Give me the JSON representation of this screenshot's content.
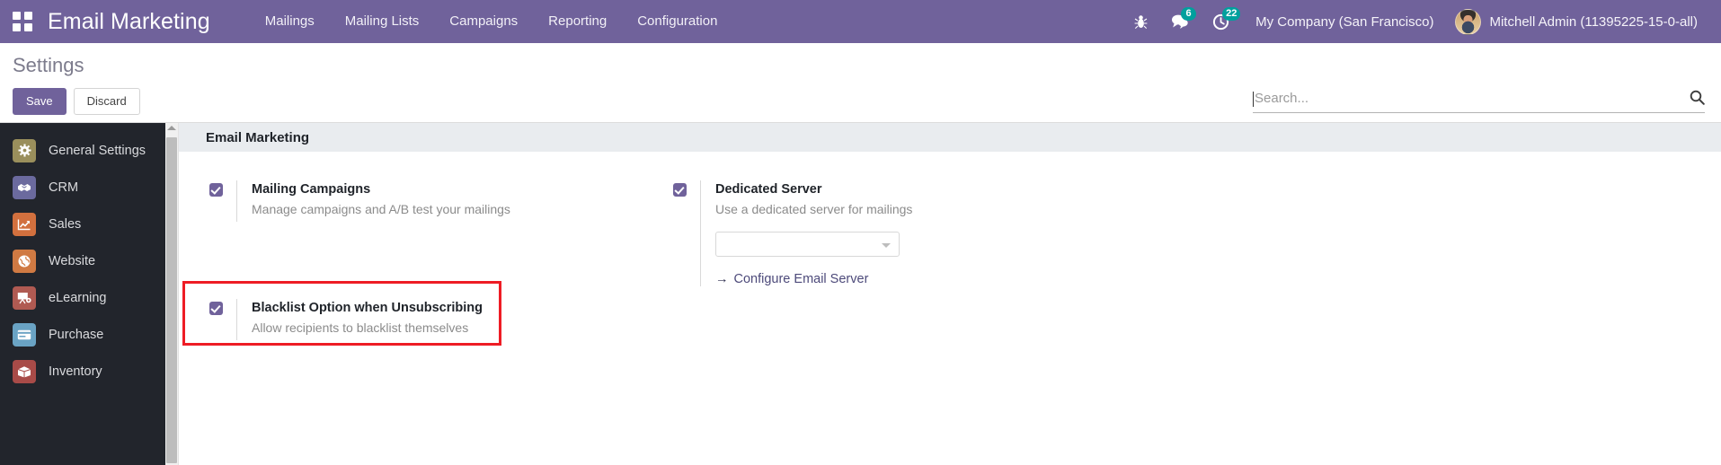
{
  "navbar": {
    "apps_icon": "apps-grid-icon",
    "brand": "Email Marketing",
    "menu": [
      {
        "label": "Mailings"
      },
      {
        "label": "Mailing Lists"
      },
      {
        "label": "Campaigns"
      },
      {
        "label": "Reporting"
      },
      {
        "label": "Configuration"
      }
    ],
    "icons": [
      {
        "name": "bug-icon",
        "glyph": "🐞",
        "badge": null
      },
      {
        "name": "messages-icon",
        "glyph": "💬",
        "badge": "6"
      },
      {
        "name": "activities-icon",
        "glyph": "🕓",
        "badge": "22"
      }
    ],
    "company": "My Company (San Francisco)",
    "user": "Mitchell Admin (11395225-15-0-all)",
    "bg_color": "#70629b",
    "badge_color": "#00a09d"
  },
  "control_panel": {
    "breadcrumb": "Settings",
    "save_label": "Save",
    "discard_label": "Discard",
    "search_placeholder": "Search...",
    "search_value": "",
    "search_icon": "search-icon"
  },
  "sidebar": {
    "items": [
      {
        "label": "General Settings",
        "icon": "gear-icon",
        "glyph": "⚙",
        "color": "#9a8f5c"
      },
      {
        "label": "CRM",
        "icon": "handshake-icon",
        "glyph": "🤝",
        "color": "#6b6a9e"
      },
      {
        "label": "Sales",
        "icon": "chart-up-icon",
        "glyph": "📈",
        "color": "#d2703e"
      },
      {
        "label": "Website",
        "icon": "globe-icon",
        "glyph": "🌐",
        "color": "#d07a43"
      },
      {
        "label": "eLearning",
        "icon": "presentation-icon",
        "glyph": "📊",
        "color": "#b05a52"
      },
      {
        "label": "Purchase",
        "icon": "card-icon",
        "glyph": "💳",
        "color": "#6aa3c4"
      },
      {
        "label": "Inventory",
        "icon": "box-icon",
        "glyph": "📦",
        "color": "#a84b48"
      }
    ]
  },
  "main": {
    "section_title": "Email Marketing",
    "left_column": [
      {
        "title": "Mailing Campaigns",
        "description": "Manage campaigns and A/B test your mailings",
        "checked": true
      },
      {
        "title": "Blacklist Option when Unsubscribing",
        "description": "Allow recipients to blacklist themselves",
        "checked": true,
        "highlighted": true
      }
    ],
    "right_column": [
      {
        "title": "Dedicated Server",
        "description": "Use a dedicated server for mailings",
        "checked": true,
        "select_value": "",
        "link_label": "Configure Email Server",
        "link_arrow": "→"
      }
    ],
    "highlight_color": "#ee1c25"
  }
}
